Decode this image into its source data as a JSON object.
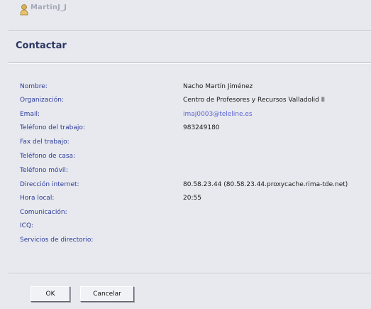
{
  "header": {
    "user_name": "MartinJ_J"
  },
  "dialog": {
    "title": "Contactar"
  },
  "fields": [
    {
      "label": "Nombre:",
      "value": "Nacho Martín Jiménez"
    },
    {
      "label": "Organización:",
      "value": "Centro de Profesores y Recursos Valladolid II"
    },
    {
      "label": "Email:",
      "value": "imaj0003@teleline.es"
    },
    {
      "label": "Teléfono del trabajo:",
      "value": "983249180"
    },
    {
      "label": "Fax del trabajo:",
      "value": ""
    },
    {
      "label": "Teléfono de casa:",
      "value": ""
    },
    {
      "label": "Teléfono móvil:",
      "value": ""
    },
    {
      "label": "Dirección internet:",
      "value": "80.58.23.44 (80.58.23.44.proxycache.rima-tde.net)"
    },
    {
      "label": "Hora local:",
      "value": "20:55"
    },
    {
      "label": "Comunicación:",
      "value": ""
    },
    {
      "label": "ICQ:",
      "value": ""
    },
    {
      "label": "Servicios de directorio:",
      "value": ""
    }
  ],
  "buttons": {
    "ok": "OK",
    "cancel": "Cancelar"
  },
  "colors": {
    "background": "#e7e9ee",
    "label": "#2b3a9a",
    "link": "#5a62d6",
    "title": "#2d3563"
  }
}
